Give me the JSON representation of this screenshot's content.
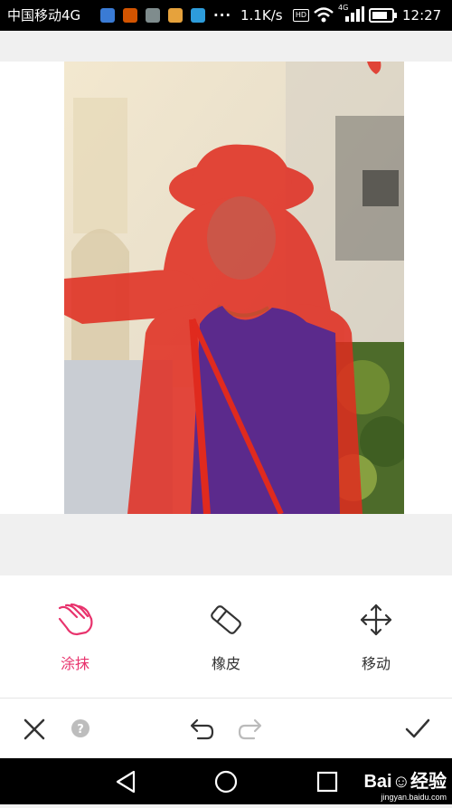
{
  "status_bar": {
    "carrier": "中国移动4G",
    "app_icons": [
      "weibo-icon",
      "app-icon",
      "image-icon",
      "app-icon",
      "telegram-icon"
    ],
    "app_colors": [
      "#3a7bd5",
      "#d35400",
      "#7f8c8d",
      "#e6a23c",
      "#2d9cdb"
    ],
    "more": "···",
    "net_speed": "1.1K/s",
    "hd": "HD",
    "network": "4G",
    "time": "12:27"
  },
  "tools": [
    {
      "label": "涂抹",
      "icon": "hand-smear-icon",
      "active": true
    },
    {
      "label": "橡皮",
      "icon": "eraser-icon",
      "active": false
    },
    {
      "label": "移动",
      "icon": "move-arrows-icon",
      "active": false
    }
  ],
  "actions": {
    "close": "close-icon",
    "help": "?",
    "undo": "undo-icon",
    "redo": "redo-icon",
    "confirm": "check-icon"
  },
  "watermark": {
    "brand": "Bai☺经验",
    "url": "jingyan.baidu.com"
  },
  "colors": {
    "accent": "#e8336d",
    "overlay": "#e02a1e",
    "dress": "#5b2a8c"
  }
}
